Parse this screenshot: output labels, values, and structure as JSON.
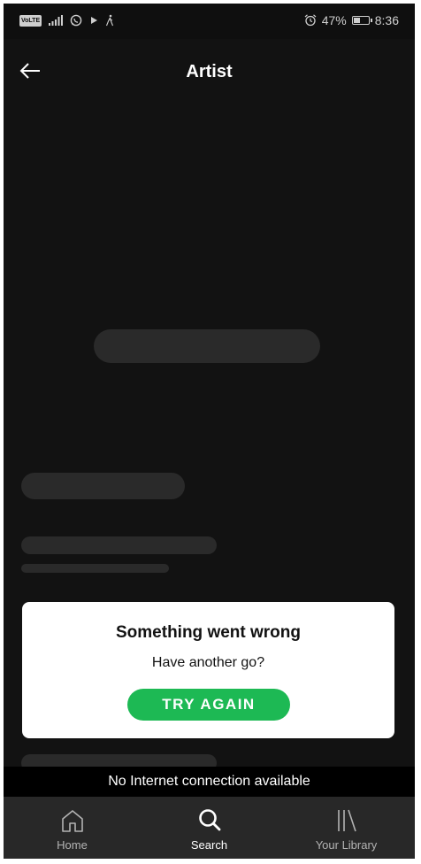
{
  "status_bar": {
    "carrier_badge": "VoLTE",
    "battery_percent": "47%",
    "battery_level": 0.47,
    "time": "8:36"
  },
  "header": {
    "title": "Artist",
    "back_icon": "arrow-left-icon"
  },
  "dialog": {
    "title": "Something went wrong",
    "subtitle": "Have another go?",
    "button_label": "TRY AGAIN"
  },
  "offline_banner": {
    "text": "No Internet connection available"
  },
  "bottom_nav": {
    "items": [
      {
        "label": "Home",
        "icon": "home-icon",
        "active": false
      },
      {
        "label": "Search",
        "icon": "search-icon",
        "active": true
      },
      {
        "label": "Your Library",
        "icon": "library-icon",
        "active": false
      }
    ]
  },
  "colors": {
    "background": "#121212",
    "skeleton": "#2a2a2a",
    "accent": "#1db954",
    "nav_background": "#282828"
  }
}
